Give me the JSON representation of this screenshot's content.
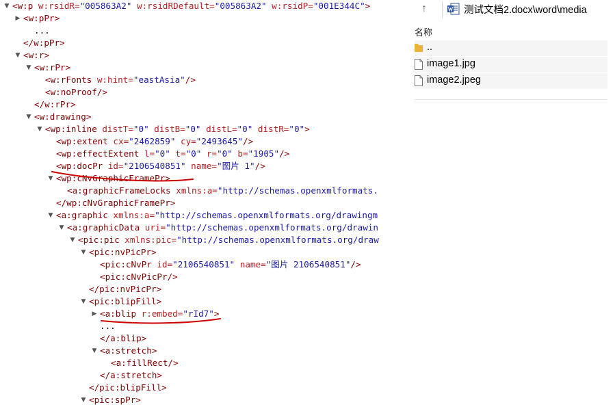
{
  "xml_tree": {
    "lines": [
      {
        "toggle": "▼",
        "segments": [
          [
            "tag",
            "<w:p "
          ],
          [
            "att",
            "w:rsidR="
          ],
          [
            "val",
            "\"005863A2\""
          ],
          [
            "att",
            " w:rsidRDefault="
          ],
          [
            "val",
            "\"005863A2\""
          ],
          [
            "att",
            " w:rsidP="
          ],
          [
            "val",
            "\"001E344C\""
          ],
          [
            "tag",
            ">"
          ]
        ]
      },
      {
        "toggle": "▶",
        "segments": [
          [
            "tag",
            "<w:pPr>"
          ]
        ]
      },
      {
        "toggle": "",
        "segments": [
          [
            "txt",
            "..."
          ]
        ]
      },
      {
        "toggle": "",
        "segments": [
          [
            "tag",
            "</w:pPr>"
          ]
        ]
      },
      {
        "toggle": "▼",
        "segments": [
          [
            "tag",
            "<w:r>"
          ]
        ]
      },
      {
        "toggle": "▼",
        "segments": [
          [
            "tag",
            "<w:rPr>"
          ]
        ]
      },
      {
        "toggle": "",
        "segments": [
          [
            "tag",
            "<w:rFonts "
          ],
          [
            "att",
            "w:hint="
          ],
          [
            "val",
            "\"eastAsia\""
          ],
          [
            "tag",
            "/>"
          ]
        ]
      },
      {
        "toggle": "",
        "segments": [
          [
            "tag",
            "<w:noProof/>"
          ]
        ]
      },
      {
        "toggle": "",
        "segments": [
          [
            "tag",
            "</w:rPr>"
          ]
        ]
      },
      {
        "toggle": "▼",
        "segments": [
          [
            "tag",
            "<w:drawing>"
          ]
        ]
      },
      {
        "toggle": "▼",
        "segments": [
          [
            "tag",
            "<wp:inline "
          ],
          [
            "att",
            "distT="
          ],
          [
            "val",
            "\"0\""
          ],
          [
            "att",
            " distB="
          ],
          [
            "val",
            "\"0\""
          ],
          [
            "att",
            " distL="
          ],
          [
            "val",
            "\"0\""
          ],
          [
            "att",
            " distR="
          ],
          [
            "val",
            "\"0\""
          ],
          [
            "tag",
            ">"
          ]
        ]
      },
      {
        "toggle": "",
        "segments": [
          [
            "tag",
            "<wp:extent "
          ],
          [
            "att",
            "cx="
          ],
          [
            "val",
            "\"2462859\""
          ],
          [
            "att",
            " cy="
          ],
          [
            "val",
            "\"2493645\""
          ],
          [
            "tag",
            "/>"
          ]
        ]
      },
      {
        "toggle": "",
        "segments": [
          [
            "tag",
            "<wp:effectExtent "
          ],
          [
            "att",
            "l="
          ],
          [
            "val",
            "\"0\""
          ],
          [
            "att",
            " t="
          ],
          [
            "val",
            "\"0\""
          ],
          [
            "att",
            " r="
          ],
          [
            "val",
            "\"0\""
          ],
          [
            "att",
            " b="
          ],
          [
            "val",
            "\"1905\""
          ],
          [
            "tag",
            "/>"
          ]
        ]
      },
      {
        "toggle": "",
        "segments": [
          [
            "tag",
            "<wp:docPr "
          ],
          [
            "att",
            "id="
          ],
          [
            "val",
            "\"2106540851\""
          ],
          [
            "att",
            " name="
          ],
          [
            "val",
            "\"图片 1\""
          ],
          [
            "tag",
            "/>"
          ]
        ]
      },
      {
        "toggle": "▼",
        "segments": [
          [
            "tag",
            "<wp:cNvGraphicFramePr>"
          ]
        ]
      },
      {
        "toggle": "",
        "segments": [
          [
            "tag",
            "<a:graphicFrameLocks "
          ],
          [
            "att",
            "xmlns:a="
          ],
          [
            "val",
            "\"http://schemas.openxmlformats."
          ]
        ]
      },
      {
        "toggle": "",
        "segments": [
          [
            "tag",
            "</wp:cNvGraphicFramePr>"
          ]
        ]
      },
      {
        "toggle": "▼",
        "segments": [
          [
            "tag",
            "<a:graphic "
          ],
          [
            "att",
            "xmlns:a="
          ],
          [
            "val",
            "\"http://schemas.openxmlformats.org/drawingm"
          ]
        ]
      },
      {
        "toggle": "▼",
        "segments": [
          [
            "tag",
            "<a:graphicData "
          ],
          [
            "att",
            "uri="
          ],
          [
            "val",
            "\"http://schemas.openxmlformats.org/drawin"
          ]
        ]
      },
      {
        "toggle": "▼",
        "segments": [
          [
            "tag",
            "<pic:pic "
          ],
          [
            "att",
            "xmlns:pic="
          ],
          [
            "val",
            "\"http://schemas.openxmlformats.org/draw"
          ]
        ]
      },
      {
        "toggle": "▼",
        "segments": [
          [
            "tag",
            "<pic:nvPicPr>"
          ]
        ]
      },
      {
        "toggle": "",
        "segments": [
          [
            "tag",
            "<pic:cNvPr "
          ],
          [
            "att",
            "id="
          ],
          [
            "val",
            "\"2106540851\""
          ],
          [
            "att",
            " name="
          ],
          [
            "val",
            "\"图片 2106540851\""
          ],
          [
            "tag",
            "/>"
          ]
        ]
      },
      {
        "toggle": "",
        "segments": [
          [
            "tag",
            "<pic:cNvPicPr/>"
          ]
        ]
      },
      {
        "toggle": "",
        "segments": [
          [
            "tag",
            "</pic:nvPicPr>"
          ]
        ]
      },
      {
        "toggle": "▼",
        "segments": [
          [
            "tag",
            "<pic:blipFill>"
          ]
        ]
      },
      {
        "toggle": "▶",
        "segments": [
          [
            "tag",
            "<a:blip "
          ],
          [
            "att",
            "r:embed="
          ],
          [
            "val",
            "\"rId7\""
          ],
          [
            "tag",
            ">"
          ]
        ]
      },
      {
        "toggle": "",
        "segments": [
          [
            "txt",
            "..."
          ]
        ]
      },
      {
        "toggle": "",
        "segments": [
          [
            "tag",
            "</a:blip>"
          ]
        ]
      },
      {
        "toggle": "▼",
        "segments": [
          [
            "tag",
            "<a:stretch>"
          ]
        ]
      },
      {
        "toggle": "",
        "segments": [
          [
            "tag",
            "<a:fillRect/>"
          ]
        ]
      },
      {
        "toggle": "",
        "segments": [
          [
            "tag",
            "</a:stretch>"
          ]
        ]
      },
      {
        "toggle": "",
        "segments": [
          [
            "tag",
            "</pic:blipFill>"
          ]
        ]
      },
      {
        "toggle": "▼",
        "segments": [
          [
            "tag",
            "<pic:spPr>"
          ]
        ]
      }
    ]
  },
  "explorer": {
    "back_icon": "up-arrow-icon",
    "path": "测试文档2.docx\\word\\media",
    "column_name": "名称",
    "items": [
      {
        "name": "..",
        "icon": "folder-icon"
      },
      {
        "name": "image1.jpg",
        "icon": "file-icon"
      },
      {
        "name": "image2.jpeg",
        "icon": "file-icon"
      }
    ]
  },
  "colors": {
    "tag": "#800000",
    "attribute": "#b22222",
    "value": "#1a1aa6",
    "annotation": "#cc0000",
    "row_bg": "#f5f5f5",
    "folder": "#e8b53a"
  }
}
